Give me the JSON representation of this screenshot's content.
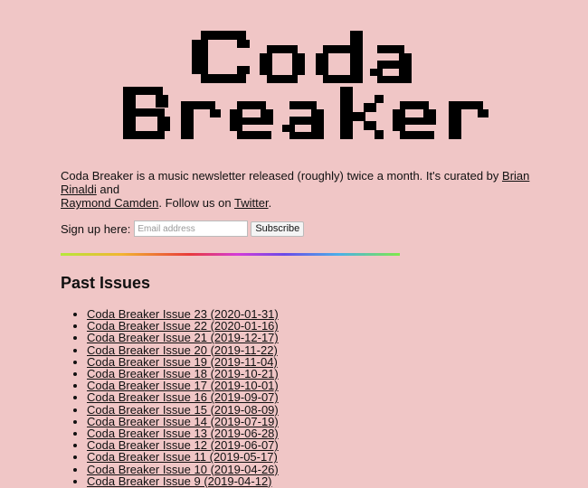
{
  "logo": {
    "line1": "Coda",
    "line2": "Breaker"
  },
  "intro": {
    "text_before": "Coda Breaker is a music newsletter released (roughly) twice a month. It's curated by ",
    "curator1": "Brian Rinaldi",
    "text_and": " and",
    "curator2": "Raymond Camden",
    "text_follow": ". Follow us on ",
    "twitter": "Twitter",
    "text_end": "."
  },
  "signup": {
    "label": "Sign up here:",
    "placeholder": "Email address",
    "button": "Subscribe"
  },
  "past_issues": {
    "heading": "Past Issues",
    "items": [
      "Coda Breaker Issue 23 (2020-01-31)",
      "Coda Breaker Issue 22 (2020-01-16)",
      "Coda Breaker Issue 21 (2019-12-17)",
      "Coda Breaker Issue 20 (2019-11-22)",
      "Coda Breaker Issue 19 (2019-11-04)",
      "Coda Breaker Issue 18 (2019-10-21)",
      "Coda Breaker Issue 17 (2019-10-01)",
      "Coda Breaker Issue 16 (2019-09-07)",
      "Coda Breaker Issue 15 (2019-08-09)",
      "Coda Breaker Issue 14 (2019-07-19)",
      "Coda Breaker Issue 13 (2019-06-28)",
      "Coda Breaker Issue 12 (2019-06-07)",
      "Coda Breaker Issue 11 (2019-05-17)",
      "Coda Breaker Issue 10 (2019-04-26)",
      "Coda Breaker Issue 9 (2019-04-12)"
    ]
  }
}
